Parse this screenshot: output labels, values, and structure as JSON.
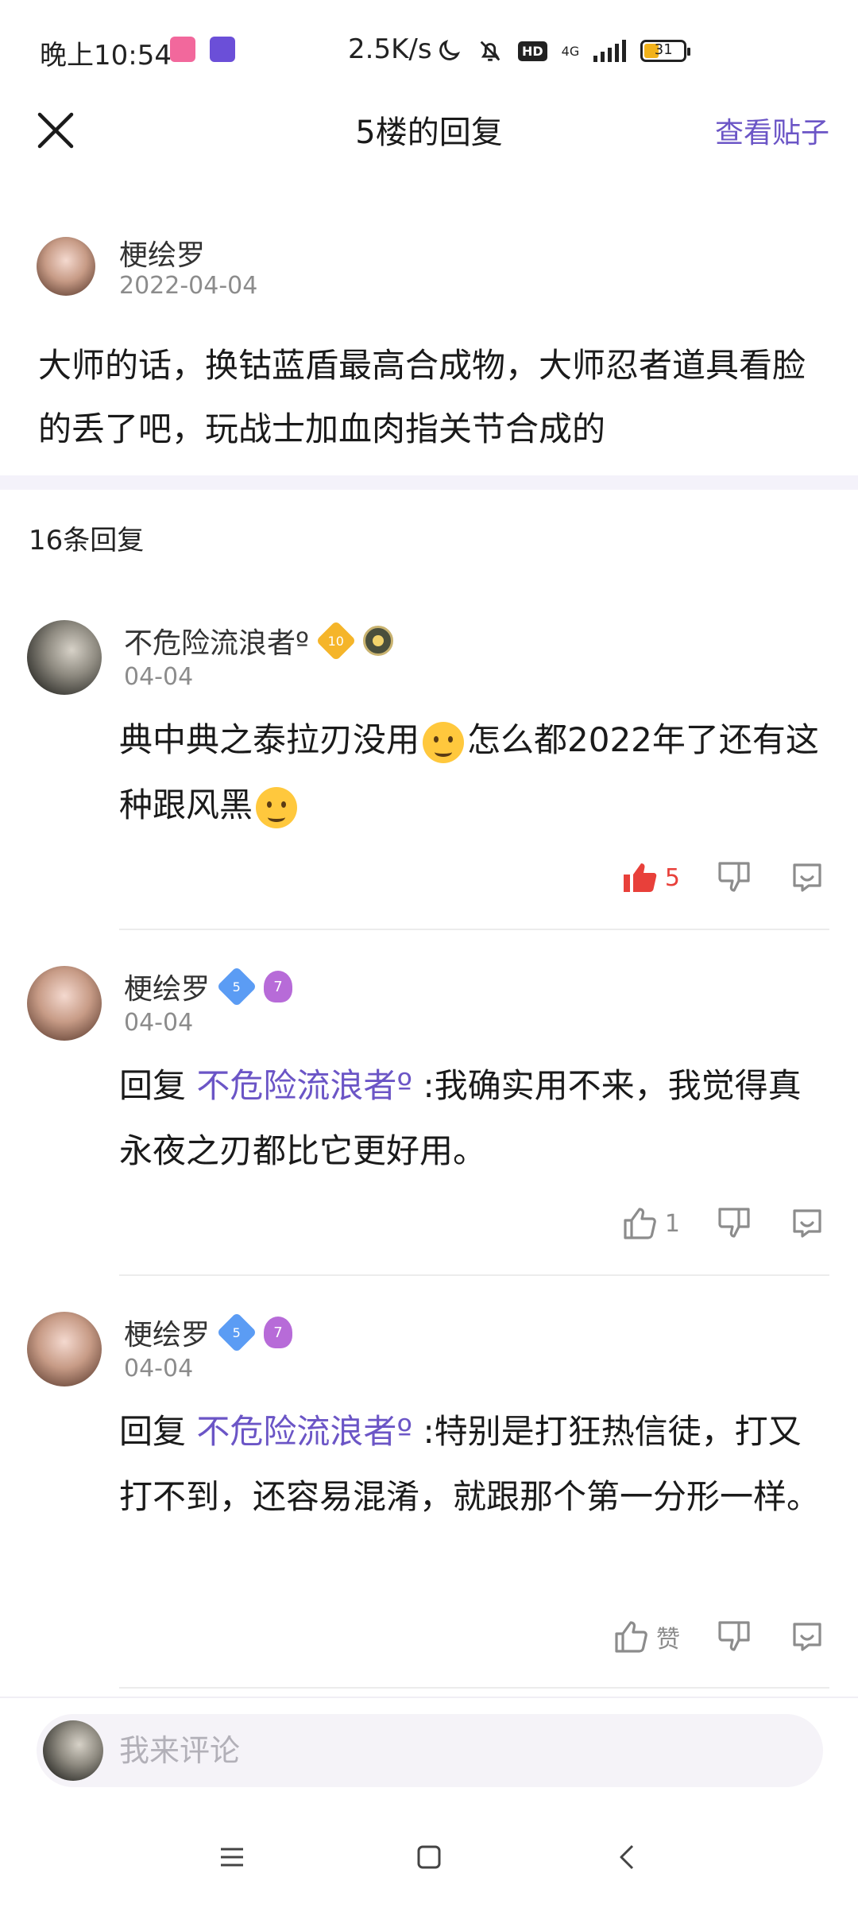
{
  "status_bar": {
    "time": "晚上10:54",
    "net_speed": "2.5K/s",
    "hd": "HD",
    "network": "4G",
    "battery": "31"
  },
  "header": {
    "title": "5楼的回复",
    "view_post": "查看贴子"
  },
  "post": {
    "author": "梗绘罗",
    "date": "2022-04-04",
    "text": "大师的话，换钴蓝盾最高合成物，大师忍者道具看脸的丢了吧，玩战士加血肉指关节合成的"
  },
  "reply_count": "16条回复",
  "replies": [
    {
      "author": "不危险流浪者º",
      "level": "10",
      "date": "04-04",
      "text_before_emoji": "典中典之泰拉刃没用",
      "text_middle": "怎么都2022年了还有这种跟风黑",
      "like_count": "5",
      "liked": true
    },
    {
      "author": "梗绘罗",
      "level": "5",
      "badge": "7",
      "date": "04-04",
      "reply_prefix": "回复 ",
      "mention": "不危险流浪者º",
      "text": " :我确实用不来，我觉得真永夜之刃都比它更好用。",
      "like_count": "1",
      "liked": false
    },
    {
      "author": "梗绘罗",
      "level": "5",
      "badge": "7",
      "date": "04-04",
      "reply_prefix": "回复 ",
      "mention": "不危险流浪者º",
      "text": " :特别是打狂热信徒，打又打不到，还容易混淆，就跟那个第一分形一样。",
      "like_count": "赞",
      "liked": false
    }
  ],
  "comment_bar": {
    "placeholder": "我来评论"
  },
  "colors": {
    "accent": "#6b55c6",
    "like_active": "#e8403a",
    "muted": "#8c8c8c"
  }
}
